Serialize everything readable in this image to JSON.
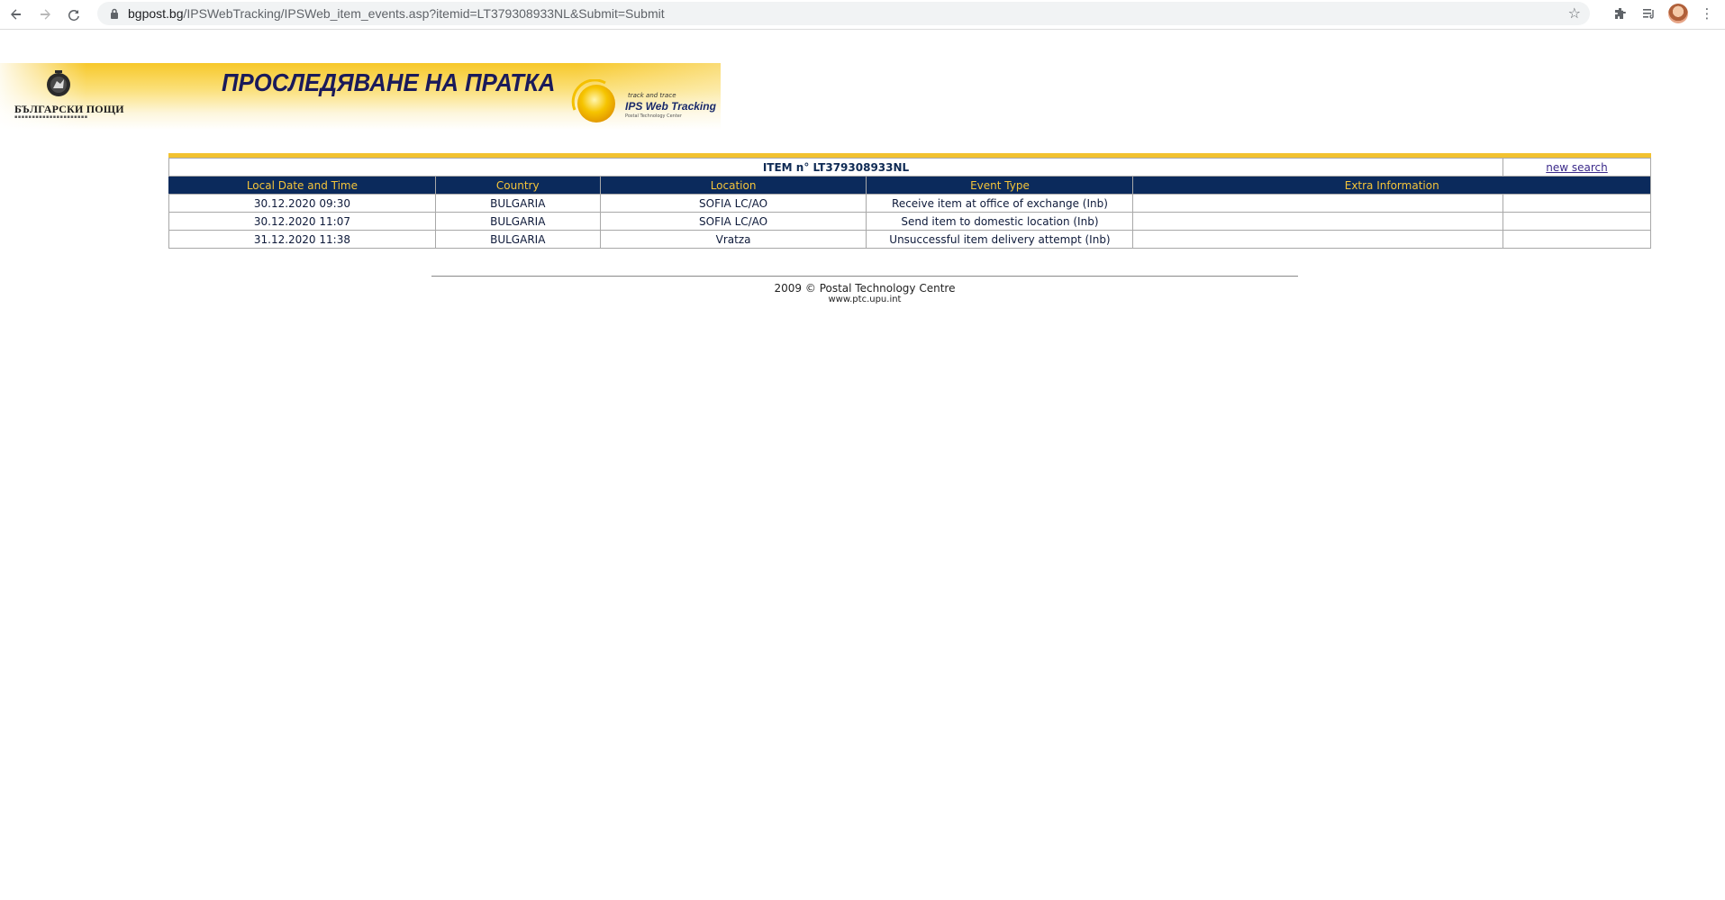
{
  "browser": {
    "url_host": "bgpost.bg",
    "url_path": "/IPSWebTracking/IPSWeb_item_events.asp?itemid=LT379308933NL&Submit=Submit",
    "icons": [
      "back-icon",
      "forward-icon",
      "reload-icon",
      "lock-icon",
      "star-icon",
      "extensions-icon",
      "reading-list-icon",
      "avatar",
      "menu-icon"
    ]
  },
  "banner": {
    "title": "ПРОСЛЕДЯВАНЕ НА ПРАТКА",
    "logo_text": "БЪЛГАРСКИ ПОЩИ",
    "ips_small": "track and trace",
    "ips_main": "IPS Web Tracking",
    "ips_ptc": "Postal Technology Center"
  },
  "tracking": {
    "item_label": "ITEM n° LT379308933NL",
    "new_search": "new search",
    "columns": [
      "Local Date and Time",
      "Country",
      "Location",
      "Event Type",
      "Extra Information"
    ],
    "rows": [
      {
        "date": "30.12.2020 09:30",
        "country": "BULGARIA",
        "location": "SOFIA LC/AO",
        "event": "Receive item at office of exchange (Inb)",
        "extra": ""
      },
      {
        "date": "30.12.2020 11:07",
        "country": "BULGARIA",
        "location": "SOFIA LC/AO",
        "event": "Send item to domestic location (Inb)",
        "extra": ""
      },
      {
        "date": "31.12.2020 11:38",
        "country": "BULGARIA",
        "location": "Vratza",
        "event": "Unsuccessful item delivery attempt (Inb)",
        "extra": ""
      }
    ]
  },
  "footer": {
    "copyright": "2009 © Postal Technology Centre",
    "link": "www.ptc.upu.int"
  },
  "colors": {
    "header_bg": "#0b2a5c",
    "header_text": "#f4c43a",
    "accent_bar": "#f2c230",
    "banner_yellow": "#f7c82a"
  }
}
